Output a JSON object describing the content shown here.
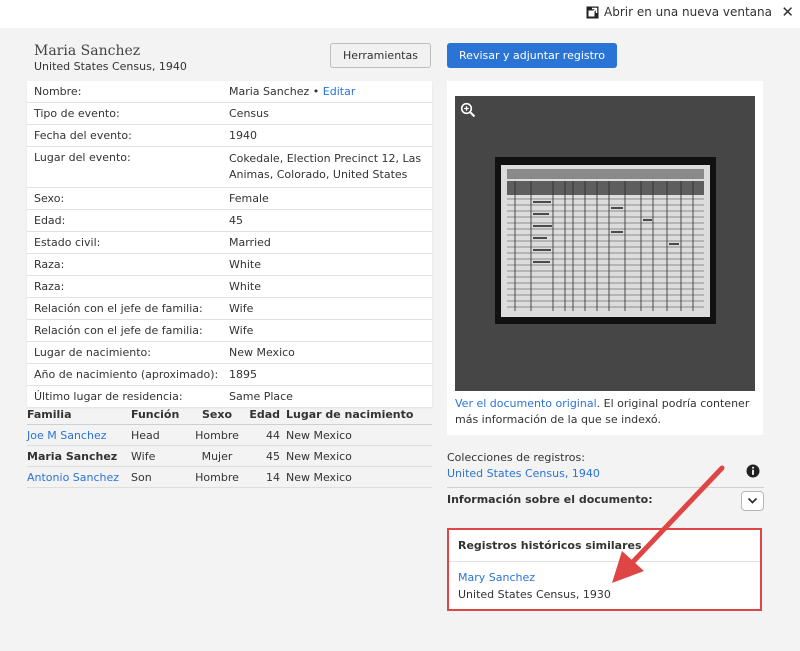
{
  "topbar": {
    "open_new_window": "Abrir en una nueva ventana",
    "close_icon": "close-icon"
  },
  "header": {
    "name": "Maria Sanchez",
    "subtitle": "United States Census, 1940",
    "tools_button": "Herramientas",
    "primary_button": "Revisar y adjuntar registro"
  },
  "details": [
    {
      "label": "Nombre:",
      "value": "Maria Sanchez •",
      "edit": "Editar"
    },
    {
      "label": "Tipo de evento:",
      "value": "Census"
    },
    {
      "label": "Fecha del evento:",
      "value": "1940"
    },
    {
      "label": "Lugar del evento:",
      "value": "Cokedale, Election Precinct 12, Las Animas, Colorado, United States"
    },
    {
      "label": "Sexo:",
      "value": "Female"
    },
    {
      "label": "Edad:",
      "value": "45"
    },
    {
      "label": "Estado civil:",
      "value": "Married"
    },
    {
      "label": "Raza:",
      "value": "White"
    },
    {
      "label": "Raza:",
      "value": "White"
    },
    {
      "label": "Relación con el jefe de familia:",
      "value": "Wife"
    },
    {
      "label": "Relación con el jefe de familia:",
      "value": "Wife"
    },
    {
      "label": "Lugar de nacimiento:",
      "value": "New Mexico"
    },
    {
      "label": "Año de nacimiento (aproximado):",
      "value": "1895"
    },
    {
      "label": "Último lugar de residencia:",
      "value": "Same Place"
    }
  ],
  "family": {
    "headers": [
      "Familia",
      "Función",
      "Sexo",
      "Edad",
      "Lugar de nacimiento"
    ],
    "rows": [
      {
        "name": "Joe M Sanchez",
        "role": "Head",
        "sex": "Hombre",
        "age": "44",
        "birthplace": "New Mexico",
        "link": true
      },
      {
        "name": "Maria Sanchez",
        "role": "Wife",
        "sex": "Mujer",
        "age": "45",
        "birthplace": "New Mexico",
        "link": false
      },
      {
        "name": "Antonio Sanchez",
        "role": "Son",
        "sex": "Hombre",
        "age": "14",
        "birthplace": "New Mexico",
        "link": true
      }
    ]
  },
  "viewer": {
    "zoom_icon": "zoom-in-icon",
    "caption_link": "Ver el documento original",
    "caption_rest": ". El original podría contener más información de la que se indexó."
  },
  "collections": {
    "label": "Colecciones de registros:",
    "link": "United States Census, 1940",
    "info_icon": "info-icon"
  },
  "doc_info": {
    "label": "Información sobre el documento:",
    "toggle_icon": "chevron-down-icon"
  },
  "similar": {
    "title": "Registros históricos similares",
    "link": "Mary Sanchez",
    "subtitle": "United States Census, 1930"
  },
  "colors": {
    "accent": "#2a74d6",
    "highlight": "#e04545"
  }
}
